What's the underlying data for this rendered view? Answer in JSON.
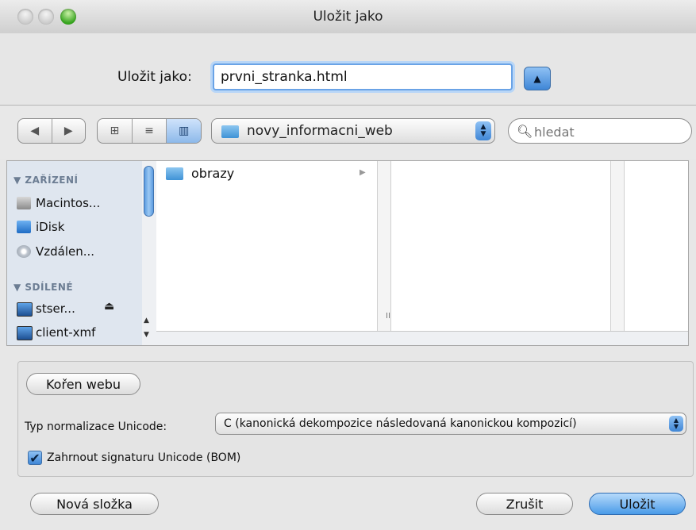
{
  "window": {
    "title": "Uložit jako"
  },
  "save": {
    "label": "Uložit jako:",
    "filename": "prvni_stranka.html",
    "expand_icon": "triangle-up-icon"
  },
  "toolbar": {
    "back_icon": "◀",
    "forward_icon": "▶",
    "view_icons": [
      "⊞",
      "≡",
      "▥"
    ],
    "location": "novy_informacni_web",
    "search_placeholder": "hledat"
  },
  "sidebar": {
    "devices_header": "▼ ZAŘÍZENÍ",
    "devices": [
      {
        "label": "Macintos...",
        "icon": "hard-disk-icon"
      },
      {
        "label": "iDisk",
        "icon": "idisk-icon"
      },
      {
        "label": "Vzdálen...",
        "icon": "remote-disc-icon"
      }
    ],
    "shared_header": "▼ SDÍLENÉ",
    "shared": [
      {
        "label": "stser...",
        "icon": "computer-icon"
      },
      {
        "label": "client-xmf",
        "icon": "computer-icon"
      }
    ],
    "eject": "⏏"
  },
  "browser": {
    "items": [
      {
        "name": "obrazy",
        "icon": "folder-icon"
      }
    ],
    "grip": "II"
  },
  "options": {
    "web_root_button": "Kořen webu",
    "normalization_label": "Typ normalizace Unicode:",
    "normalization_value": "C (kanonická dekompozice následovaná kanonickou kompozicí)",
    "bom_checkbox": {
      "label": "Zahrnout signaturu Unicode (BOM)",
      "checked": true,
      "mark": "✔"
    }
  },
  "buttons": {
    "new_folder": "Nová složka",
    "cancel": "Zrušit",
    "save": "Uložit"
  }
}
